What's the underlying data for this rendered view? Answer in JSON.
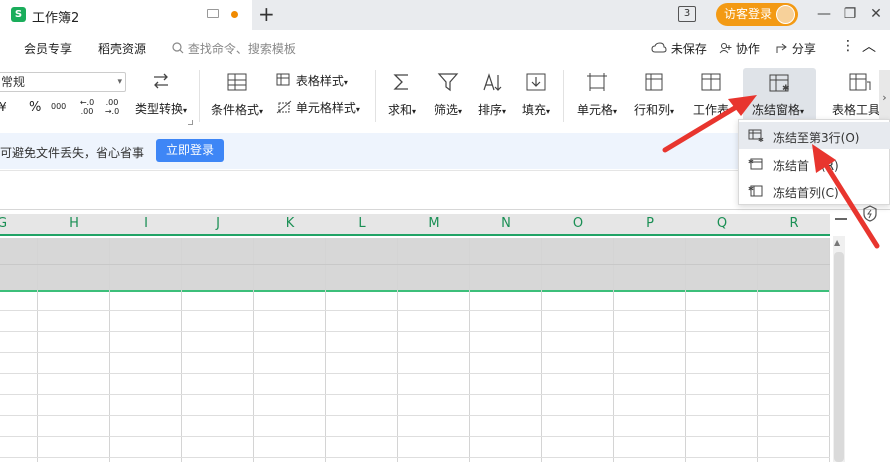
{
  "titlebar": {
    "doc_icon_letter": "S",
    "doc_name": "工作簿2",
    "new_tab_symbol": "+",
    "window_count": "3",
    "login_label": "访客登录",
    "minimize": "—",
    "restore": "❐",
    "close": "✕"
  },
  "menubar": {
    "items": [
      "会员专享",
      "稻壳资源"
    ],
    "search_placeholder": "查找命令、搜索模板",
    "right": {
      "unsaved": "未保存",
      "collab": "协作",
      "share": "分享",
      "more": "⋮",
      "collapse": "︿"
    }
  },
  "ribbon": {
    "number_format": "常规",
    "currency_symbol": "¥",
    "percent_symbol": "%",
    "thousands_symbol": "000",
    "inc_decimal": "←.0 .00",
    "dec_decimal": ".00 →.0",
    "type_convert": "类型转换",
    "cond_format": "条件格式",
    "table_style": "表格样式",
    "cell_style": "单元格样式",
    "sum": "求和",
    "filter": "筛选",
    "sort": "排序",
    "fill": "填充",
    "cell": "单元格",
    "row_col": "行和列",
    "worksheet": "工作表",
    "freeze": "冻结窗格",
    "table_tools": "表格工具",
    "caret": "▾"
  },
  "notice": {
    "text": "可避免文件丢失，省心省事",
    "button": "立即登录"
  },
  "columns": [
    "G",
    "H",
    "I",
    "J",
    "K",
    "L",
    "M",
    "N",
    "O",
    "P",
    "Q",
    "R"
  ],
  "dropdown": {
    "items": [
      "冻结至第3行(O)",
      "冻结首行(R)",
      "冻结首列(C)"
    ],
    "visible_items": [
      "冻结至第3行(O)",
      "冻结首",
      "(R)",
      "冻结首列(C)"
    ]
  },
  "colors": {
    "accent_green": "#21a366",
    "login_orange": "#f39a14",
    "notice_button_blue": "#3e86f6",
    "arrow_red": "#e8352e"
  }
}
